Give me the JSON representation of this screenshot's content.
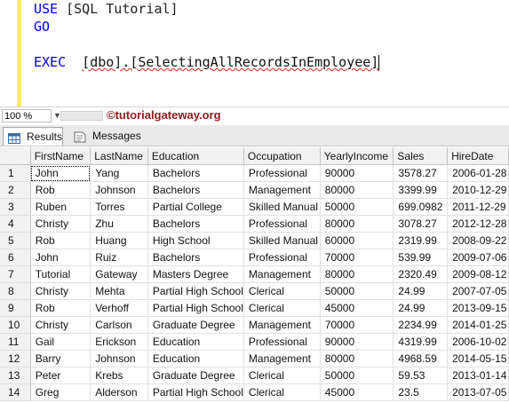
{
  "editor": {
    "line1": {
      "kw": "USE",
      "rest": " [SQL Tutorial]"
    },
    "line2": {
      "kw": "GO"
    },
    "line3": {
      "kw": "EXEC",
      "rest": "  ",
      "proc": "[dbo].[SelectingAllRecordsInEmployee]"
    }
  },
  "status": {
    "zoom": "100 %",
    "copyright": "©tutorialgateway.org"
  },
  "tabs": {
    "results": "Results",
    "messages": "Messages"
  },
  "grid": {
    "columns": [
      "FirstName",
      "LastName",
      "Education",
      "Occupation",
      "YearlyIncome",
      "Sales",
      "HireDate"
    ],
    "rows": [
      [
        "1",
        "John",
        "Yang",
        "Bachelors",
        "Professional",
        "90000",
        "3578.27",
        "2006-01-28"
      ],
      [
        "2",
        "Rob",
        "Johnson",
        "Bachelors",
        "Management",
        "80000",
        "3399.99",
        "2010-12-29"
      ],
      [
        "3",
        "Ruben",
        "Torres",
        "Partial College",
        "Skilled Manual",
        "50000",
        "699.0982",
        "2011-12-29"
      ],
      [
        "4",
        "Christy",
        "Zhu",
        "Bachelors",
        "Professional",
        "80000",
        "3078.27",
        "2012-12-28"
      ],
      [
        "5",
        "Rob",
        "Huang",
        "High School",
        "Skilled Manual",
        "60000",
        "2319.99",
        "2008-09-22"
      ],
      [
        "6",
        "John",
        "Ruiz",
        "Bachelors",
        "Professional",
        "70000",
        "539.99",
        "2009-07-06"
      ],
      [
        "7",
        "Tutorial",
        "Gateway",
        "Masters Degree",
        "Management",
        "80000",
        "2320.49",
        "2009-08-12"
      ],
      [
        "8",
        "Christy",
        "Mehta",
        "Partial High School",
        "Clerical",
        "50000",
        "24.99",
        "2007-07-05"
      ],
      [
        "9",
        "Rob",
        "Verhoff",
        "Partial High School",
        "Clerical",
        "45000",
        "24.99",
        "2013-09-15"
      ],
      [
        "10",
        "Christy",
        "Carlson",
        "Graduate Degree",
        "Management",
        "70000",
        "2234.99",
        "2014-01-25"
      ],
      [
        "11",
        "Gail",
        "Erickson",
        "Education",
        "Professional",
        "90000",
        "4319.99",
        "2006-10-02"
      ],
      [
        "12",
        "Barry",
        "Johnson",
        "Education",
        "Management",
        "80000",
        "4968.59",
        "2014-05-15"
      ],
      [
        "13",
        "Peter",
        "Krebs",
        "Graduate Degree",
        "Clerical",
        "50000",
        "59.53",
        "2013-01-14"
      ],
      [
        "14",
        "Greg",
        "Alderson",
        "Partial High School",
        "Clerical",
        "45000",
        "23.5",
        "2013-07-05"
      ]
    ]
  }
}
